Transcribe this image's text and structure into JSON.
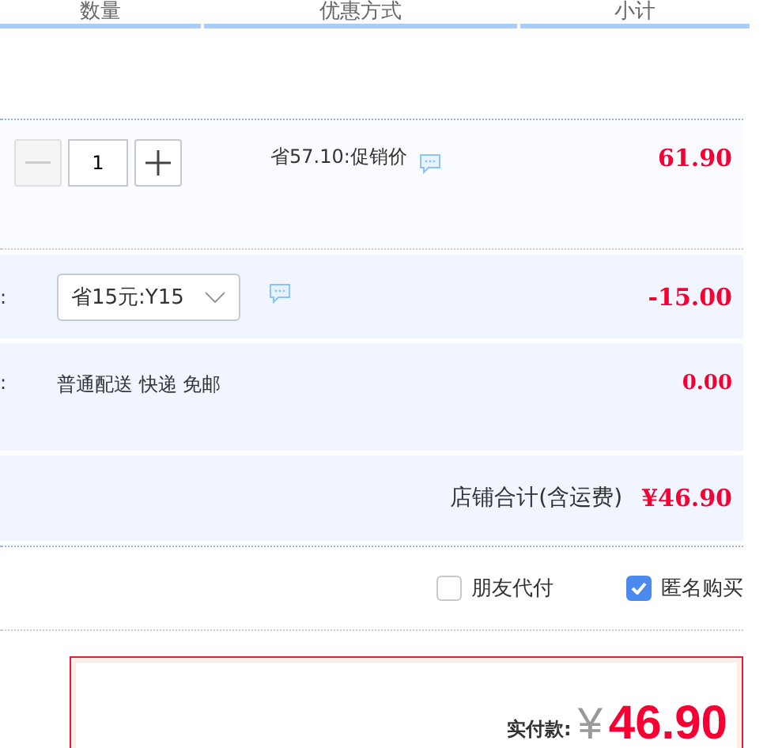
{
  "columns": [
    "数量",
    "优惠方式",
    "小计"
  ],
  "item": {
    "quantity": "1",
    "promotion": "省57.10:促销价",
    "subtotal": "61.90"
  },
  "coupon": {
    "label": ":",
    "value": "省15元:Y15",
    "amount": "-15.00"
  },
  "shipping": {
    "label": ":",
    "value": "普通配送 快递 免邮",
    "amount": "0.00"
  },
  "shop_total": {
    "label": "店铺合计(含运费)",
    "amount": "¥46.90"
  },
  "options": [
    {
      "label": "朋友代付",
      "checked": false
    },
    {
      "label": "匿名购买",
      "checked": true
    }
  ],
  "payment": {
    "label": "实付款:",
    "currency": "¥",
    "amount": "46.90"
  }
}
